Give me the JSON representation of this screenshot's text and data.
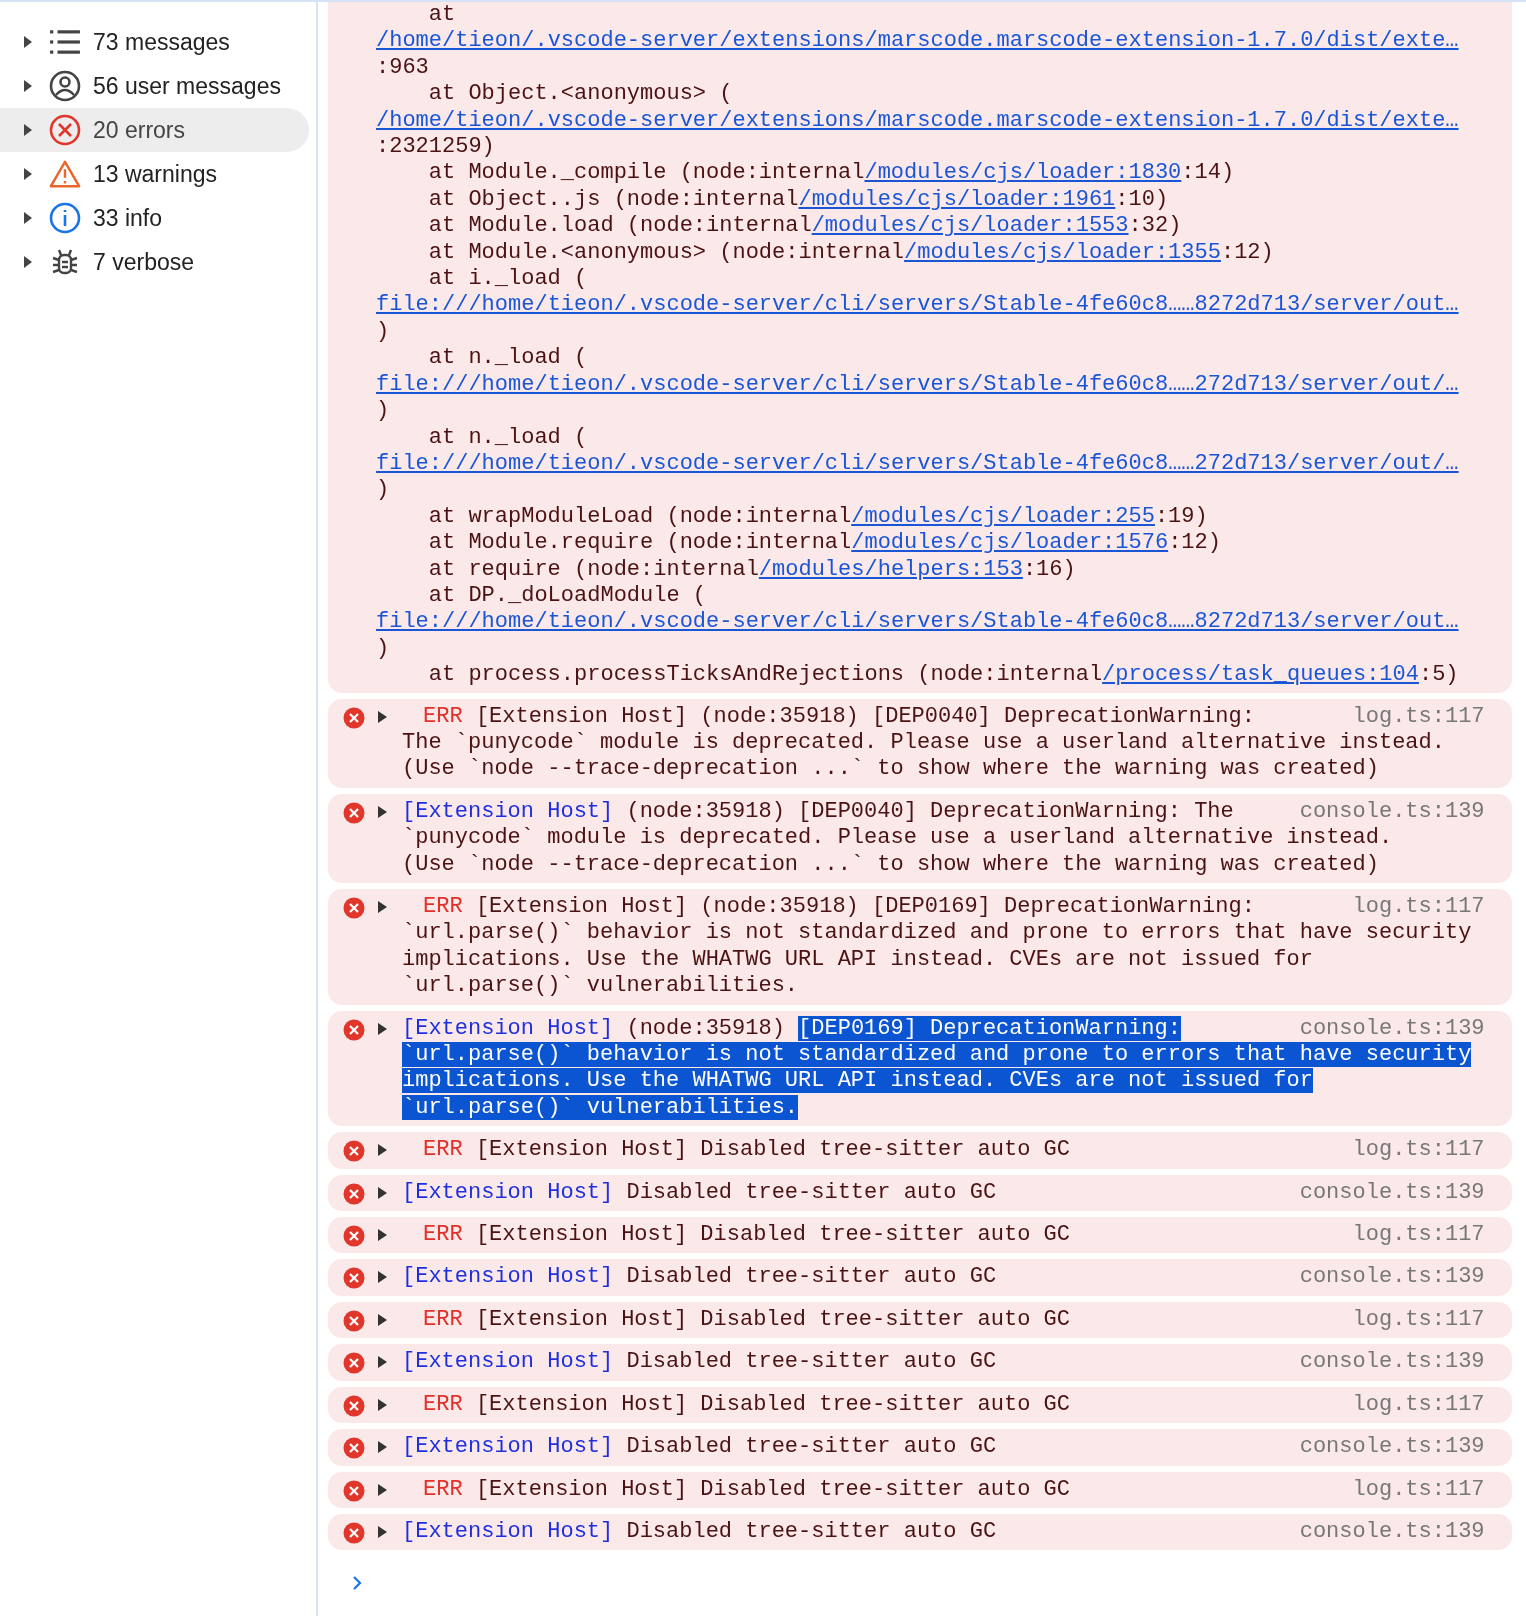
{
  "sidebar": {
    "items": [
      {
        "label": "73 messages",
        "selected": false,
        "expanded": false
      },
      {
        "label": "56 user messages",
        "selected": false,
        "expanded": false
      },
      {
        "label": "20 errors",
        "selected": true,
        "expanded": false
      },
      {
        "label": "13 warnings",
        "selected": false,
        "expanded": false
      },
      {
        "label": "33 info",
        "selected": false,
        "expanded": false
      },
      {
        "label": "7 verbose",
        "selected": false,
        "expanded": false
      }
    ]
  },
  "stack": {
    "lines": [
      {
        "indented": true,
        "parts": [
          {
            "text": "at",
            "link": false
          }
        ]
      },
      {
        "indented": false,
        "parts": [
          {
            "text": "/home/tieon/.vscode-server/extensions/marscode.marscode-extension-1.7.0/dist/exte…",
            "link": true
          }
        ]
      },
      {
        "indented": false,
        "parts": [
          {
            "text": ":963",
            "link": false
          }
        ]
      },
      {
        "indented": true,
        "parts": [
          {
            "text": "at Object.<anonymous> (",
            "link": false
          }
        ]
      },
      {
        "indented": false,
        "parts": [
          {
            "text": "/home/tieon/.vscode-server/extensions/marscode.marscode-extension-1.7.0/dist/exte…",
            "link": true
          }
        ]
      },
      {
        "indented": false,
        "parts": [
          {
            "text": ":2321259)",
            "link": false
          }
        ]
      },
      {
        "indented": true,
        "parts": [
          {
            "text": "at Module._compile (node:internal",
            "link": false
          },
          {
            "text": "/modules/cjs/loader:1830",
            "link": true
          },
          {
            "text": ":14)",
            "link": false
          }
        ]
      },
      {
        "indented": true,
        "parts": [
          {
            "text": "at Object..js (node:internal",
            "link": false
          },
          {
            "text": "/modules/cjs/loader:1961",
            "link": true
          },
          {
            "text": ":10)",
            "link": false
          }
        ]
      },
      {
        "indented": true,
        "parts": [
          {
            "text": "at Module.load (node:internal",
            "link": false
          },
          {
            "text": "/modules/cjs/loader:1553",
            "link": true
          },
          {
            "text": ":32)",
            "link": false
          }
        ]
      },
      {
        "indented": true,
        "parts": [
          {
            "text": "at Module.<anonymous> (node:internal",
            "link": false
          },
          {
            "text": "/modules/cjs/loader:1355",
            "link": true
          },
          {
            "text": ":12)",
            "link": false
          }
        ]
      },
      {
        "indented": true,
        "parts": [
          {
            "text": "at i._load (",
            "link": false
          }
        ]
      },
      {
        "indented": false,
        "parts": [
          {
            "text": "file:///home/tieon/.vscode-server/cli/servers/Stable-4fe60c8……8272d713/server/out…",
            "link": true
          }
        ]
      },
      {
        "indented": false,
        "parts": [
          {
            "text": ")",
            "link": false
          }
        ]
      },
      {
        "indented": true,
        "parts": [
          {
            "text": "at n._load (",
            "link": false
          }
        ]
      },
      {
        "indented": false,
        "parts": [
          {
            "text": "file:///home/tieon/.vscode-server/cli/servers/Stable-4fe60c8……272d713/server/out/…",
            "link": true
          }
        ]
      },
      {
        "indented": false,
        "parts": [
          {
            "text": ")",
            "link": false
          }
        ]
      },
      {
        "indented": true,
        "parts": [
          {
            "text": "at n._load (",
            "link": false
          }
        ]
      },
      {
        "indented": false,
        "parts": [
          {
            "text": "file:///home/tieon/.vscode-server/cli/servers/Stable-4fe60c8……272d713/server/out/…",
            "link": true
          }
        ]
      },
      {
        "indented": false,
        "parts": [
          {
            "text": ")",
            "link": false
          }
        ]
      },
      {
        "indented": true,
        "parts": [
          {
            "text": "at wrapModuleLoad (node:internal",
            "link": false
          },
          {
            "text": "/modules/cjs/loader:255",
            "link": true
          },
          {
            "text": ":19)",
            "link": false
          }
        ]
      },
      {
        "indented": true,
        "parts": [
          {
            "text": "at Module.require (node:internal",
            "link": false
          },
          {
            "text": "/modules/cjs/loader:1576",
            "link": true
          },
          {
            "text": ":12)",
            "link": false
          }
        ]
      },
      {
        "indented": true,
        "parts": [
          {
            "text": "at require (node:internal",
            "link": false
          },
          {
            "text": "/modules/helpers:153",
            "link": true
          },
          {
            "text": ":16)",
            "link": false
          }
        ]
      },
      {
        "indented": true,
        "parts": [
          {
            "text": "at DP._doLoadModule (",
            "link": false
          }
        ]
      },
      {
        "indented": false,
        "parts": [
          {
            "text": "file:///home/tieon/.vscode-server/cli/servers/Stable-4fe60c8……8272d713/server/out…",
            "link": true
          }
        ]
      },
      {
        "indented": false,
        "parts": [
          {
            "text": ")",
            "link": false
          }
        ]
      },
      {
        "indented": true,
        "parts": [
          {
            "text": "at process.processTicksAndRejections (node:internal",
            "link": false
          },
          {
            "text": "/process/task_queues:104",
            "link": true
          },
          {
            "text": ":5)",
            "link": false
          }
        ]
      }
    ]
  },
  "messages": [
    {
      "kind": "log",
      "expanded": false,
      "level": "ERR",
      "source": "[Extension Host]",
      "head": [
        {
          "text": "(node:35918) [DEP0040] DeprecationWarning:",
          "selected": false
        }
      ],
      "location": "log.ts:117",
      "tail": [
        {
          "text": "The `punycode` module is deprecated. Please use a userland alternative instead.\n(Use `node --trace-deprecation ...` to show where the warning was created)",
          "selected": false
        }
      ]
    },
    {
      "kind": "console",
      "expanded": false,
      "source": "[Extension Host]",
      "head": [
        {
          "text": "(node:35918) [DEP0040] DeprecationWarning: The",
          "selected": false
        }
      ],
      "location": "console.ts:139",
      "tail": [
        {
          "text": "`punycode` module is deprecated. Please use a userland alternative instead.\n(Use `node --trace-deprecation ...` to show where the warning was created)",
          "selected": false
        }
      ]
    },
    {
      "kind": "log",
      "expanded": false,
      "level": "ERR",
      "source": "[Extension Host]",
      "head": [
        {
          "text": "(node:35918) [DEP0169] DeprecationWarning:",
          "selected": false
        }
      ],
      "location": "log.ts:117",
      "tail": [
        {
          "text": "`url.parse()` behavior is not standardized and prone to errors that have security implications. Use the WHATWG URL API instead. CVEs are not issued for `url.parse()` vulnerabilities.",
          "selected": false
        }
      ]
    },
    {
      "kind": "console",
      "expanded": false,
      "source": "[Extension Host]",
      "head": [
        {
          "text": "(node:35918)",
          "selected": false
        },
        {
          "text": "[DEP0169] DeprecationWarning:",
          "selected": true
        }
      ],
      "location": "console.ts:139",
      "tail": [
        {
          "text": "`url.parse()` behavior is not standardized and prone to errors that have security implications. Use the WHATWG URL API instead. CVEs are not issued for `url.parse()` vulnerabilities.",
          "selected": true
        }
      ]
    },
    {
      "kind": "log",
      "expanded": false,
      "level": "ERR",
      "source": "[Extension Host]",
      "text": "Disabled tree-sitter auto GC",
      "location": "log.ts:117"
    },
    {
      "kind": "console",
      "expanded": false,
      "source": "[Extension Host]",
      "text": "Disabled tree-sitter auto GC",
      "location": "console.ts:139"
    },
    {
      "kind": "log",
      "expanded": false,
      "level": "ERR",
      "source": "[Extension Host]",
      "text": "Disabled tree-sitter auto GC",
      "location": "log.ts:117"
    },
    {
      "kind": "console",
      "expanded": false,
      "source": "[Extension Host]",
      "text": "Disabled tree-sitter auto GC",
      "location": "console.ts:139"
    },
    {
      "kind": "log",
      "expanded": false,
      "level": "ERR",
      "source": "[Extension Host]",
      "text": "Disabled tree-sitter auto GC",
      "location": "log.ts:117"
    },
    {
      "kind": "console",
      "expanded": false,
      "source": "[Extension Host]",
      "text": "Disabled tree-sitter auto GC",
      "location": "console.ts:139"
    },
    {
      "kind": "log",
      "expanded": false,
      "level": "ERR",
      "source": "[Extension Host]",
      "text": "Disabled tree-sitter auto GC",
      "location": "log.ts:117"
    },
    {
      "kind": "console",
      "expanded": false,
      "source": "[Extension Host]",
      "text": "Disabled tree-sitter auto GC",
      "location": "console.ts:139"
    },
    {
      "kind": "log",
      "expanded": false,
      "level": "ERR",
      "source": "[Extension Host]",
      "text": "Disabled tree-sitter auto GC",
      "location": "log.ts:117"
    },
    {
      "kind": "console",
      "expanded": false,
      "source": "[Extension Host]",
      "text": "Disabled tree-sitter auto GC",
      "location": "console.ts:139"
    }
  ]
}
